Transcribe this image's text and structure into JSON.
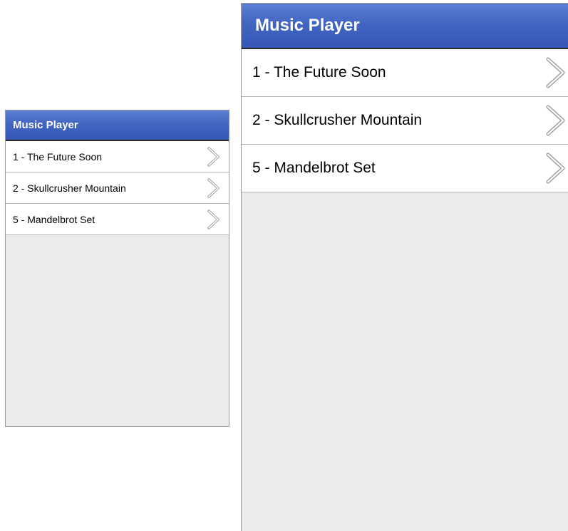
{
  "app": {
    "title": "Music Player"
  },
  "tracks": [
    {
      "label": "1 - The Future Soon"
    },
    {
      "label": "2 - Skullcrusher Mountain"
    },
    {
      "label": "5 - Mandelbrot Set"
    }
  ],
  "icons": {
    "row_action": "chevron-right-icon"
  },
  "colors": {
    "titlebar": "#4265c2",
    "titlebar_text": "#ffffff",
    "list_bg": "#ffffff",
    "panel_bg": "#ebebeb",
    "separator": "#b4b4b4"
  }
}
